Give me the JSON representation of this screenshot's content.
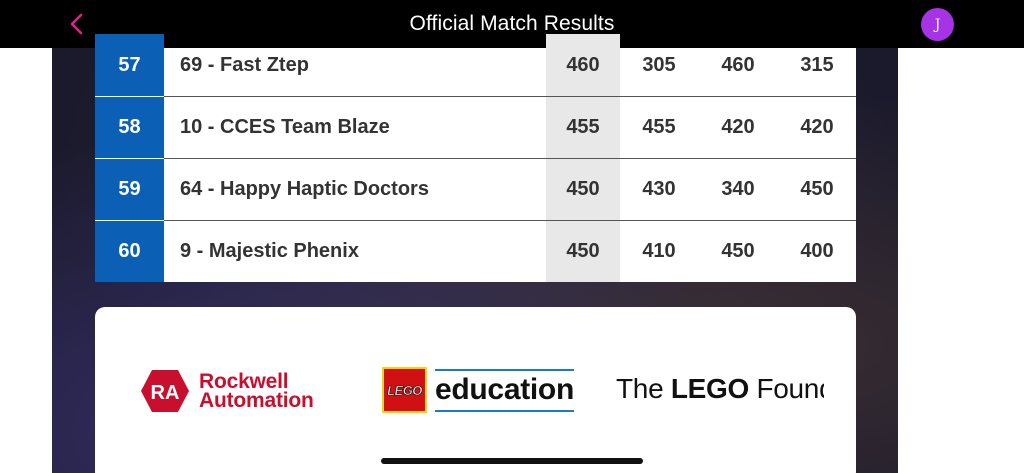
{
  "header": {
    "title": "Official Match Results",
    "avatar_initial": "J",
    "back_icon": "chevron-left-icon",
    "accent_color": "#e0218a",
    "avatar_color": "#a633e6"
  },
  "results": {
    "rows": [
      {
        "rank": "57",
        "team": "69 - Fast Ztep",
        "high": "460",
        "r1": "305",
        "r2": "460",
        "r3": "315"
      },
      {
        "rank": "58",
        "team": "10 - CCES Team Blaze",
        "high": "455",
        "r1": "455",
        "r2": "420",
        "r3": "420"
      },
      {
        "rank": "59",
        "team": "64 - Happy Haptic Doctors",
        "high": "450",
        "r1": "430",
        "r2": "340",
        "r3": "450"
      },
      {
        "rank": "60",
        "team": "9 - Majestic Phenix",
        "high": "450",
        "r1": "410",
        "r2": "450",
        "r3": "400"
      }
    ],
    "rank_color": "#0b5fb5"
  },
  "sponsors": {
    "rockwell_line1": "Rockwell",
    "rockwell_line2": "Automation",
    "rockwell_badge": "RA",
    "lego_badge": "LEGO",
    "lego_education": "education",
    "foundation_prefix": "The ",
    "foundation_bold": "LEGO",
    "foundation_suffix": " Found"
  }
}
